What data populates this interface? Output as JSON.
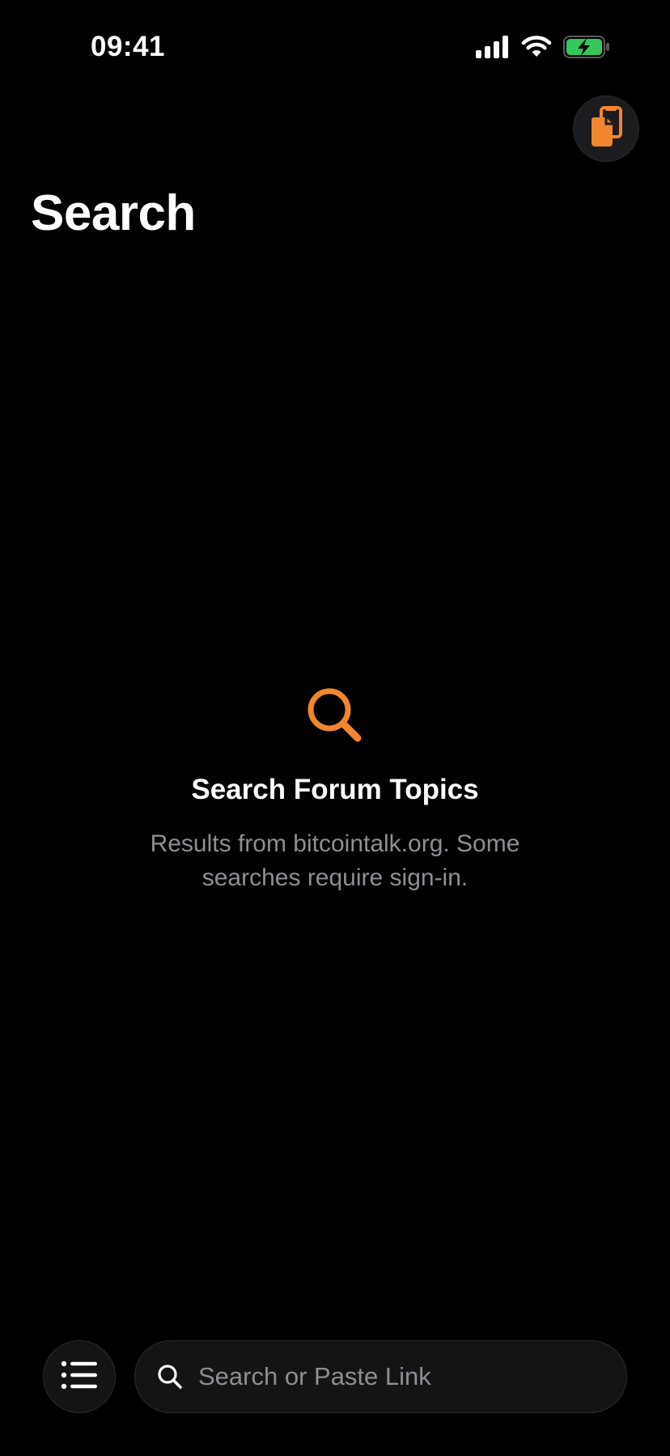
{
  "status_bar": {
    "time": "09:41",
    "icons": [
      "cellular-signal-icon",
      "wifi-icon",
      "battery-charging-icon"
    ]
  },
  "header": {
    "title": "Search",
    "action_icon": "clipboard-paste-icon"
  },
  "empty_state": {
    "icon": "magnifying-glass-icon",
    "title": "Search Forum Topics",
    "subtitle": "Results from bitcointalk.org. Some searches require sign-in."
  },
  "bottom_bar": {
    "menu_icon": "list-icon",
    "search": {
      "icon": "search-icon",
      "value": "",
      "placeholder": "Search or Paste Link"
    }
  },
  "colors": {
    "background": "#000000",
    "accent": "#F0862E",
    "battery": "#34C759",
    "secondary_text": "#8E8E93",
    "control_fill": "#141414"
  }
}
